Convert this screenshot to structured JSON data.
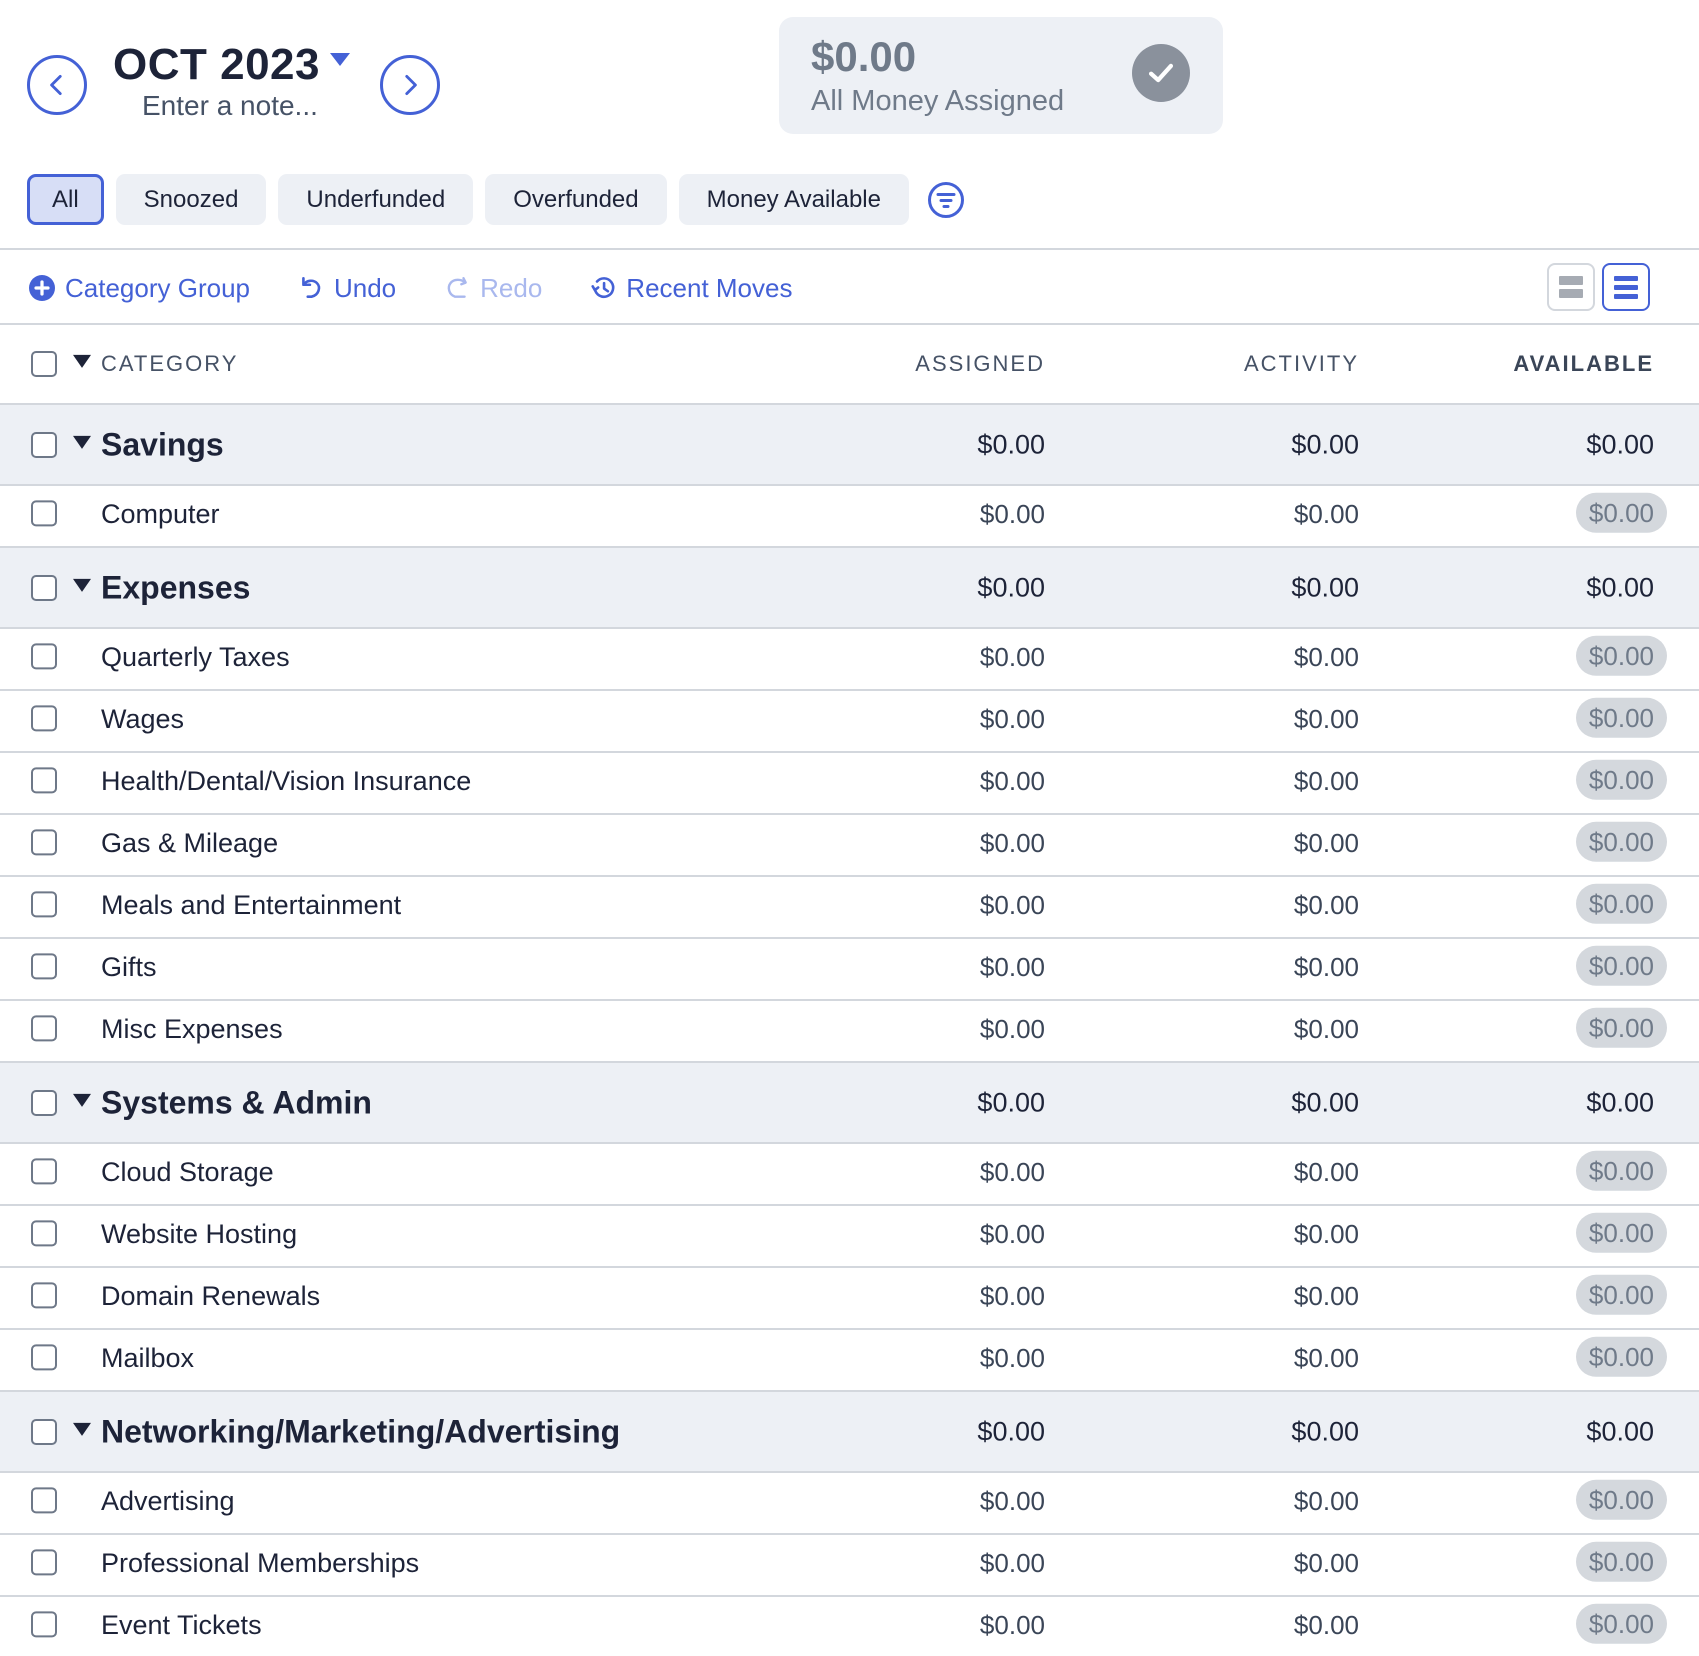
{
  "header": {
    "month": "OCT 2023",
    "note_placeholder": "Enter a note...",
    "prev_icon": "chevron-left-icon",
    "next_icon": "chevron-right-icon"
  },
  "summary": {
    "amount": "$0.00",
    "label": "All Money Assigned",
    "icon": "check-circle-icon"
  },
  "filters": {
    "items": [
      {
        "label": "All",
        "active": true
      },
      {
        "label": "Snoozed",
        "active": false
      },
      {
        "label": "Underfunded",
        "active": false
      },
      {
        "label": "Overfunded",
        "active": false
      },
      {
        "label": "Money Available",
        "active": false
      }
    ],
    "filter_icon": "filter-icon"
  },
  "toolbar": {
    "category_group": "Category Group",
    "undo": "Undo",
    "redo": "Redo",
    "recent_moves": "Recent Moves"
  },
  "colors": {
    "accent": "#4461d6",
    "group_bg": "#edf0f5",
    "text": "#1d2338",
    "pill_bg": "#d4d8dd"
  },
  "table": {
    "columns": {
      "category": "CATEGORY",
      "assigned": "ASSIGNED",
      "activity": "ACTIVITY",
      "available": "AVAILABLE"
    },
    "rows": [
      {
        "type": "group",
        "name": "Savings",
        "assigned": "$0.00",
        "activity": "$0.00",
        "available": "$0.00"
      },
      {
        "type": "item",
        "name": "Computer",
        "assigned": "$0.00",
        "activity": "$0.00",
        "available": "$0.00"
      },
      {
        "type": "group",
        "name": "Expenses",
        "assigned": "$0.00",
        "activity": "$0.00",
        "available": "$0.00"
      },
      {
        "type": "item",
        "name": "Quarterly Taxes",
        "assigned": "$0.00",
        "activity": "$0.00",
        "available": "$0.00"
      },
      {
        "type": "item",
        "name": "Wages",
        "assigned": "$0.00",
        "activity": "$0.00",
        "available": "$0.00"
      },
      {
        "type": "item",
        "name": "Health/Dental/Vision Insurance",
        "assigned": "$0.00",
        "activity": "$0.00",
        "available": "$0.00"
      },
      {
        "type": "item",
        "name": "Gas & Mileage",
        "assigned": "$0.00",
        "activity": "$0.00",
        "available": "$0.00"
      },
      {
        "type": "item",
        "name": "Meals and Entertainment",
        "assigned": "$0.00",
        "activity": "$0.00",
        "available": "$0.00"
      },
      {
        "type": "item",
        "name": "Gifts",
        "assigned": "$0.00",
        "activity": "$0.00",
        "available": "$0.00"
      },
      {
        "type": "item",
        "name": "Misc Expenses",
        "assigned": "$0.00",
        "activity": "$0.00",
        "available": "$0.00"
      },
      {
        "type": "group",
        "name": "Systems & Admin",
        "assigned": "$0.00",
        "activity": "$0.00",
        "available": "$0.00"
      },
      {
        "type": "item",
        "name": "Cloud Storage",
        "assigned": "$0.00",
        "activity": "$0.00",
        "available": "$0.00"
      },
      {
        "type": "item",
        "name": "Website Hosting",
        "assigned": "$0.00",
        "activity": "$0.00",
        "available": "$0.00"
      },
      {
        "type": "item",
        "name": "Domain Renewals",
        "assigned": "$0.00",
        "activity": "$0.00",
        "available": "$0.00"
      },
      {
        "type": "item",
        "name": "Mailbox",
        "assigned": "$0.00",
        "activity": "$0.00",
        "available": "$0.00"
      },
      {
        "type": "group",
        "name": "Networking/Marketing/Advertising",
        "assigned": "$0.00",
        "activity": "$0.00",
        "available": "$0.00"
      },
      {
        "type": "item",
        "name": "Advertising",
        "assigned": "$0.00",
        "activity": "$0.00",
        "available": "$0.00"
      },
      {
        "type": "item",
        "name": "Professional Memberships",
        "assigned": "$0.00",
        "activity": "$0.00",
        "available": "$0.00"
      },
      {
        "type": "item",
        "name": "Event Tickets",
        "assigned": "$0.00",
        "activity": "$0.00",
        "available": "$0.00"
      }
    ]
  }
}
